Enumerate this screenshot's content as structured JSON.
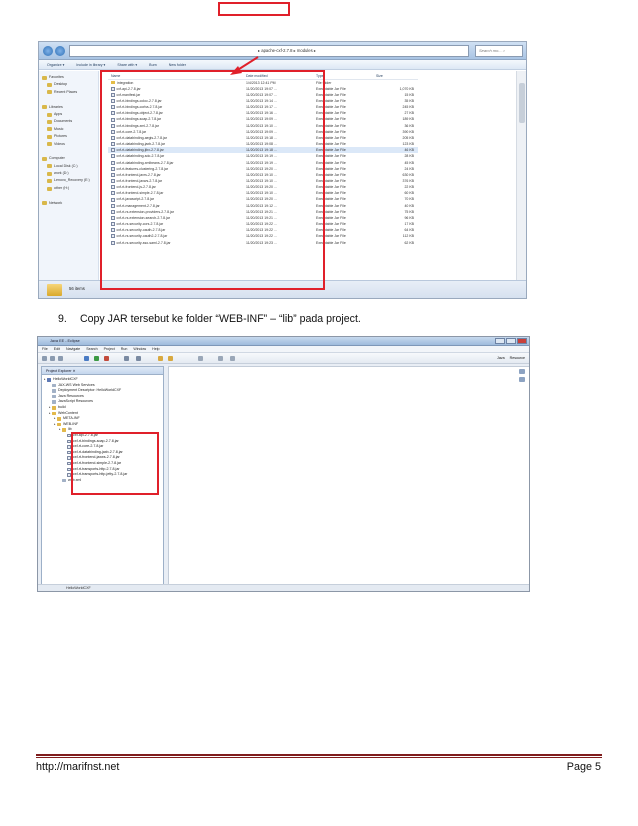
{
  "step": {
    "number": "9.",
    "text": "Copy JAR tersebut ke folder “WEB-INF” – “lib” pada project."
  },
  "footer": {
    "url": "http://marifnst.net",
    "page": "Page 5"
  },
  "explorer": {
    "breadcrumb": "▸ apache-cxf-2.7.8 ▸ modules ▸",
    "search_placeholder": "Search mo... ⌕",
    "toolbar": [
      "Organize ▾",
      "Include in library ▾",
      "Share with ▾",
      "Burn",
      "New folder"
    ],
    "columns": [
      "Name",
      "Date modified",
      "Type",
      "Size"
    ],
    "sidebar": [
      {
        "label": "Favorites",
        "icon": "star-icon"
      },
      {
        "label": "Desktop",
        "icon": "desktop-icon"
      },
      {
        "label": "Recent Places",
        "icon": "recent-icon"
      },
      {
        "label": "",
        "icon": ""
      },
      {
        "label": "Libraries",
        "icon": "library-icon"
      },
      {
        "label": "Apps",
        "icon": "folder-icon"
      },
      {
        "label": "Documents",
        "icon": "documents-icon"
      },
      {
        "label": "Music",
        "icon": "music-icon"
      },
      {
        "label": "Pictures",
        "icon": "pictures-icon"
      },
      {
        "label": "Videos",
        "icon": "videos-icon"
      },
      {
        "label": "",
        "icon": ""
      },
      {
        "label": "Computer",
        "icon": "computer-icon"
      },
      {
        "label": "Local Disk (C:)",
        "icon": "drive-icon"
      },
      {
        "label": "work (D:)",
        "icon": "drive-icon"
      },
      {
        "label": "Lenovo_Recovery (E:)",
        "icon": "drive-icon"
      },
      {
        "label": "other (H:)",
        "icon": "drive-icon"
      },
      {
        "label": "",
        "icon": ""
      },
      {
        "label": "Network",
        "icon": "network-icon"
      }
    ],
    "files": [
      {
        "name": "integration",
        "date": "1/4/2013 12:41 PM",
        "type": "File folder",
        "size": "",
        "folder": true
      },
      {
        "name": "cxf-api-2.7.8.jar",
        "date": "11/20/2013 19:07 ...",
        "type": "Executable Jar File",
        "size": "1,070 KB"
      },
      {
        "name": "cxf-manifest.jar",
        "date": "11/20/2013 19:07 ...",
        "type": "Executable Jar File",
        "size": "15 KB"
      },
      {
        "name": "cxf-rt-bindings-coloc-2.7.8.jar",
        "date": "11/20/2013 19:14 ...",
        "type": "Executable Jar File",
        "size": "35 KB"
      },
      {
        "name": "cxf-rt-bindings-corba-2.7.8.jar",
        "date": "11/20/2013 19:17 ...",
        "type": "Executable Jar File",
        "size": "245 KB"
      },
      {
        "name": "cxf-rt-bindings-object-2.7.8.jar",
        "date": "11/20/2013 19:16 ...",
        "type": "Executable Jar File",
        "size": "27 KB"
      },
      {
        "name": "cxf-rt-bindings-soap-2.7.8.jar",
        "date": "11/20/2013 19:09 ...",
        "type": "Executable Jar File",
        "size": "189 KB"
      },
      {
        "name": "cxf-rt-bindings-xml-2.7.8.jar",
        "date": "11/20/2013 19:10 ...",
        "type": "Executable Jar File",
        "size": "36 KB"
      },
      {
        "name": "cxf-rt-core-2.7.8.jar",
        "date": "11/20/2013 19:09 ...",
        "type": "Executable Jar File",
        "size": "390 KB"
      },
      {
        "name": "cxf-rt-databinding-aegis-2.7.8.jar",
        "date": "11/20/2013 19:18 ...",
        "type": "Executable Jar File",
        "size": "205 KB"
      },
      {
        "name": "cxf-rt-databinding-jaxb-2.7.8.jar",
        "date": "11/20/2013 19:08 ...",
        "type": "Executable Jar File",
        "size": "123 KB"
      },
      {
        "name": "cxf-rt-databinding-jibx-2.7.8.jar",
        "date": "11/20/2013 19:18 ...",
        "type": "Executable Jar File",
        "size": "46 KB",
        "selected": true
      },
      {
        "name": "cxf-rt-databinding-sdo-2.7.8.jar",
        "date": "11/20/2013 19:19 ...",
        "type": "Executable Jar File",
        "size": "28 KB"
      },
      {
        "name": "cxf-rt-databinding-xmlbeans-2.7.8.jar",
        "date": "11/20/2013 19:19 ...",
        "type": "Executable Jar File",
        "size": "45 KB"
      },
      {
        "name": "cxf-rt-features-clustering-2.7.8.jar",
        "date": "11/20/2013 19:20 ...",
        "type": "Executable Jar File",
        "size": "24 KB"
      },
      {
        "name": "cxf-rt-frontend-jaxrs-2.7.8.jar",
        "date": "11/20/2013 19:10 ...",
        "type": "Executable Jar File",
        "size": "630 KB"
      },
      {
        "name": "cxf-rt-frontend-jaxws-2.7.8.jar",
        "date": "11/20/2013 19:10 ...",
        "type": "Executable Jar File",
        "size": "376 KB"
      },
      {
        "name": "cxf-rt-frontend-js-2.7.8.jar",
        "date": "11/20/2013 19:20 ...",
        "type": "Executable Jar File",
        "size": "22 KB"
      },
      {
        "name": "cxf-rt-frontend-simple-2.7.8.jar",
        "date": "11/20/2013 19:10 ...",
        "type": "Executable Jar File",
        "size": "60 KB"
      },
      {
        "name": "cxf-rt-javascript-2.7.8.jar",
        "date": "11/20/2013 19:20 ...",
        "type": "Executable Jar File",
        "size": "70 KB"
      },
      {
        "name": "cxf-rt-management-2.7.8.jar",
        "date": "11/20/2013 19:12 ...",
        "type": "Executable Jar File",
        "size": "40 KB"
      },
      {
        "name": "cxf-rt-rs-extension-providers-2.7.8.jar",
        "date": "11/20/2013 19:21 ...",
        "type": "Executable Jar File",
        "size": "75 KB"
      },
      {
        "name": "cxf-rt-rs-extension-search-2.7.8.jar",
        "date": "11/20/2013 19:21 ...",
        "type": "Executable Jar File",
        "size": "96 KB"
      },
      {
        "name": "cxf-rt-rs-security-cors-2.7.8.jar",
        "date": "11/20/2013 19:22 ...",
        "type": "Executable Jar File",
        "size": "17 KB"
      },
      {
        "name": "cxf-rt-rs-security-oauth-2.7.8.jar",
        "date": "11/20/2013 19:22 ...",
        "type": "Executable Jar File",
        "size": "64 KB"
      },
      {
        "name": "cxf-rt-rs-security-oauth2-2.7.8.jar",
        "date": "11/20/2013 19:22 ...",
        "type": "Executable Jar File",
        "size": "112 KB"
      },
      {
        "name": "cxf-rt-rs-security-sso-saml-2.7.8.jar",
        "date": "11/20/2013 19:23 ...",
        "type": "Executable Jar File",
        "size": "62 KB"
      }
    ],
    "status_count": "56 items"
  },
  "eclipse": {
    "title": "Java EE - Eclipse",
    "menu": [
      "File",
      "Edit",
      "Navigate",
      "Search",
      "Project",
      "Run",
      "Window",
      "Help"
    ],
    "perspectives": [
      "Java",
      "Resource"
    ],
    "explorer_tab": "Project Explorer ✕",
    "tree": [
      {
        "label": "HelloWorldCXF",
        "indent": 0,
        "icon": "project"
      },
      {
        "label": "JAX-WS Web Services",
        "indent": 1,
        "icon": "misc"
      },
      {
        "label": "Deployment Descriptor: HelloWorldCXF",
        "indent": 1,
        "icon": "misc"
      },
      {
        "label": "Java Resources",
        "indent": 1,
        "icon": "misc"
      },
      {
        "label": "JavaScript Resources",
        "indent": 1,
        "icon": "misc"
      },
      {
        "label": "build",
        "indent": 1,
        "icon": "folder"
      },
      {
        "label": "WebContent",
        "indent": 1,
        "icon": "folder"
      },
      {
        "label": "META-INF",
        "indent": 2,
        "icon": "folder"
      },
      {
        "label": "WEB-INF",
        "indent": 2,
        "icon": "folder"
      },
      {
        "label": "lib",
        "indent": 3,
        "icon": "folder"
      },
      {
        "label": "cxf-api-2.7.8.jar",
        "indent": 4,
        "icon": "jar"
      },
      {
        "label": "cxf-rt-bindings-soap-2.7.8.jar",
        "indent": 4,
        "icon": "jar"
      },
      {
        "label": "cxf-rt-core-2.7.8.jar",
        "indent": 4,
        "icon": "jar"
      },
      {
        "label": "cxf-rt-databinding-jaxb-2.7.8.jar",
        "indent": 4,
        "icon": "jar"
      },
      {
        "label": "cxf-rt-frontend-jaxws-2.7.8.jar",
        "indent": 4,
        "icon": "jar"
      },
      {
        "label": "cxf-rt-frontend-simple-2.7.8.jar",
        "indent": 4,
        "icon": "jar"
      },
      {
        "label": "cxf-rt-transports-http-2.7.8.jar",
        "indent": 4,
        "icon": "jar"
      },
      {
        "label": "cxf-rt-transports-http-jetty-2.7.8.jar",
        "indent": 4,
        "icon": "jar"
      },
      {
        "label": "web.xml",
        "indent": 3,
        "icon": "misc"
      }
    ],
    "status": "HelloWorldCXF"
  }
}
